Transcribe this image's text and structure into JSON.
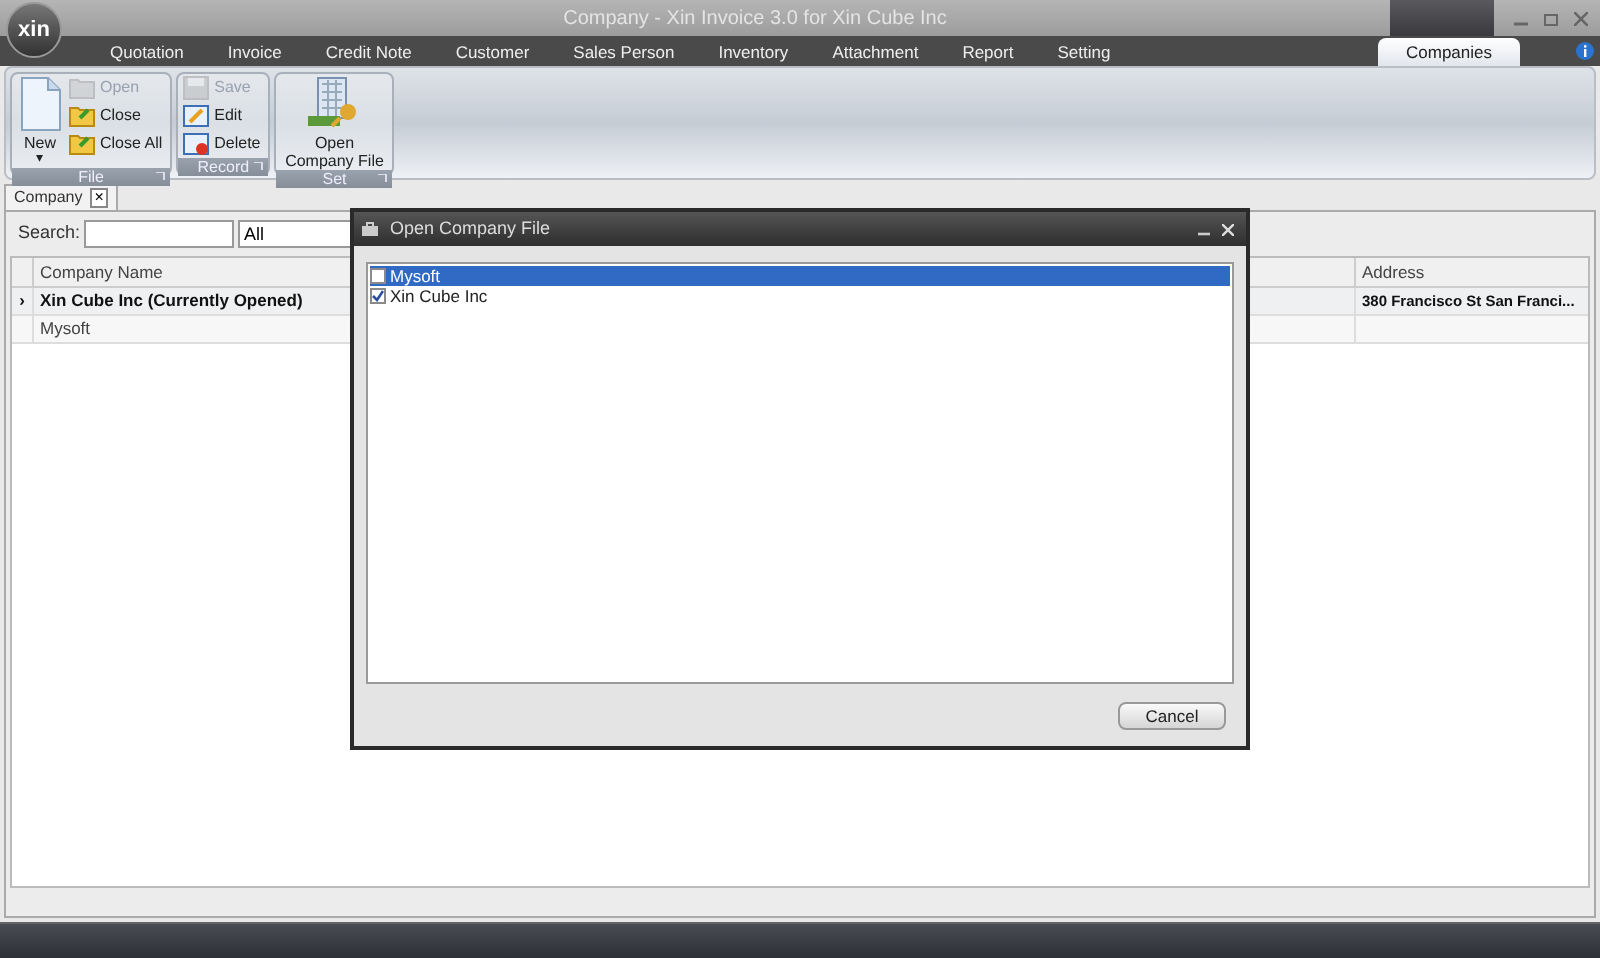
{
  "app": {
    "logo": "xin",
    "title": "Company - Xin Invoice 3.0 for Xin Cube Inc"
  },
  "menu_tabs": [
    {
      "label": "Quotation",
      "selected": false
    },
    {
      "label": "Invoice",
      "selected": false
    },
    {
      "label": "Credit Note",
      "selected": false
    },
    {
      "label": "Customer",
      "selected": false
    },
    {
      "label": "Sales Person",
      "selected": false
    },
    {
      "label": "Inventory",
      "selected": false
    },
    {
      "label": "Attachment",
      "selected": false
    },
    {
      "label": "Report",
      "selected": false
    },
    {
      "label": "Setting",
      "selected": false
    },
    {
      "label": "Companies",
      "selected": true
    }
  ],
  "ribbon_groups": [
    {
      "label": "File",
      "buttons": [
        {
          "kind": "large",
          "label": "New",
          "caret": "▾",
          "disabled": false
        },
        {
          "kind": "small",
          "label": "Open",
          "disabled": true
        },
        {
          "kind": "small",
          "label": "Close",
          "disabled": false
        },
        {
          "kind": "small",
          "label": "Close All",
          "disabled": false
        }
      ]
    },
    {
      "label": "Record",
      "buttons": [
        {
          "kind": "small",
          "label": "Save",
          "disabled": true
        },
        {
          "kind": "small",
          "label": "Edit",
          "disabled": false
        },
        {
          "kind": "small",
          "label": "Delete",
          "disabled": false
        }
      ]
    },
    {
      "label": "Set",
      "buttons": [
        {
          "kind": "large",
          "label": "Open Company File",
          "disabled": false
        }
      ]
    }
  ],
  "document_tab": {
    "label": "Company",
    "close": "×"
  },
  "search": {
    "label": "Search:",
    "filter": "All"
  },
  "table": {
    "columns": [
      "Company Name",
      "Address"
    ],
    "rows": [
      {
        "current": true,
        "marker": "›",
        "name": "Xin Cube Inc (Currently Opened)",
        "address": "380 Francisco St San Franci..."
      },
      {
        "current": false,
        "name": "Mysoft"
      }
    ]
  },
  "dialog": {
    "title": "Open Company File",
    "items": [
      {
        "label": "Mysoft",
        "checked": false,
        "selected": true
      },
      {
        "label": "Xin Cube Inc",
        "checked": true,
        "selected": false
      }
    ],
    "button": "Cancel"
  }
}
